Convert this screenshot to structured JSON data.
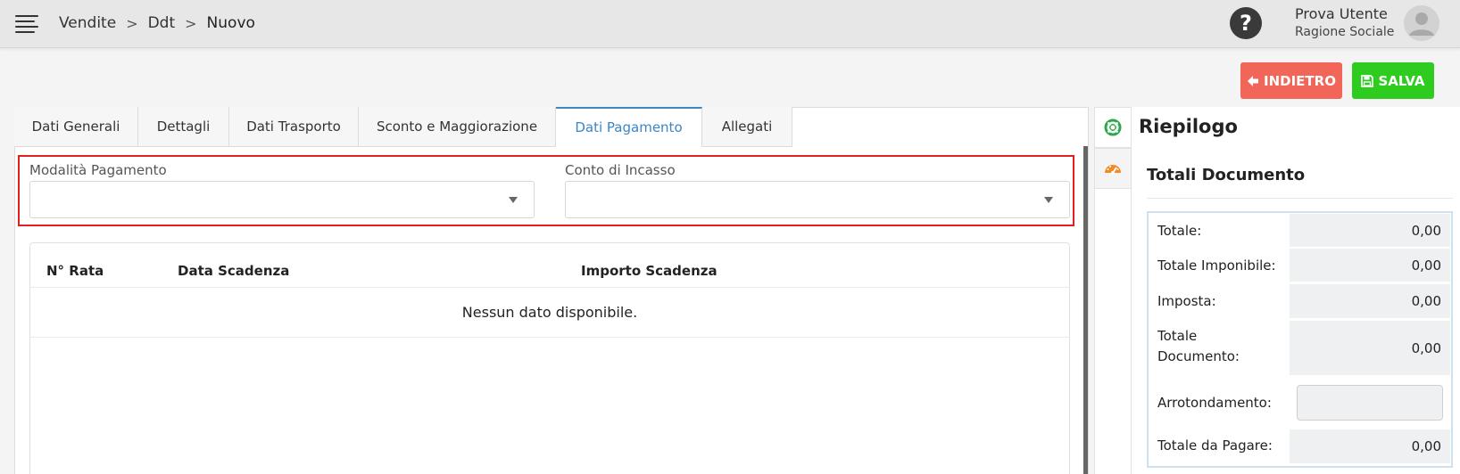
{
  "header": {
    "breadcrumb": [
      "Vendite",
      "Ddt",
      "Nuovo"
    ],
    "breadcrumb_separator": ">",
    "help_label": "?",
    "user_name": "Prova Utente",
    "user_company": "Ragione Sociale"
  },
  "actions": {
    "back_label": "INDIETRO",
    "save_label": "SALVA",
    "back_color": "#f2665a",
    "save_color": "#2ecc1f"
  },
  "tabs": [
    {
      "label": "Dati Generali",
      "active": false
    },
    {
      "label": "Dettagli",
      "active": false
    },
    {
      "label": "Dati Trasporto",
      "active": false
    },
    {
      "label": "Sconto e Maggiorazione",
      "active": false
    },
    {
      "label": "Dati Pagamento",
      "active": true
    },
    {
      "label": "Allegati",
      "active": false
    }
  ],
  "payment_form": {
    "modalita_label": "Modalità Pagamento",
    "modalita_value": "",
    "conto_label": "Conto di Incasso",
    "conto_value": ""
  },
  "installments_table": {
    "columns": [
      "N° Rata",
      "Data Scadenza",
      "Importo Scadenza"
    ],
    "rows": [],
    "empty_message": "Nessun dato disponibile."
  },
  "summary": {
    "title": "Riepilogo",
    "section_title": "Totali Documento",
    "side_icons": [
      "lifebuoy-icon",
      "dashboard-gauge-icon"
    ],
    "rows": [
      {
        "label": "Totale:",
        "value": "0,00"
      },
      {
        "label": "Totale Imponibile:",
        "value": "0,00"
      },
      {
        "label": "Imposta:",
        "value": "0,00"
      },
      {
        "label": "Totale Documento:",
        "value": "0,00"
      },
      {
        "label": "Arrotondamento:",
        "value": ""
      },
      {
        "label": "Totale da Pagare:",
        "value": "0,00"
      }
    ]
  }
}
